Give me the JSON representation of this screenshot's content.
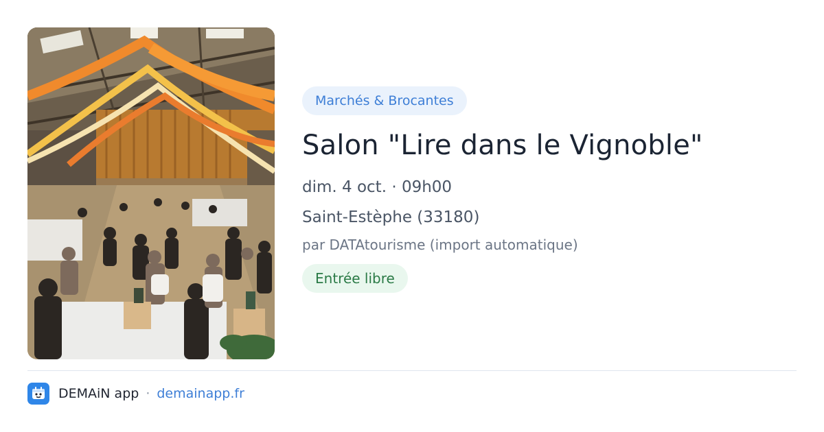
{
  "event": {
    "category": "Marchés & Brocantes",
    "title": "Salon \"Lire dans le Vignoble\"",
    "datetime": "dim. 4 oct. · 09h00",
    "location": "Saint-Estèphe (33180)",
    "source": "par DATAtourisme (import automatique)",
    "price": "Entrée libre",
    "image": "event-photo"
  },
  "footer": {
    "app_icon": "demain-app-icon",
    "app_name": "DEMAiN app",
    "separator": "·",
    "link": "demainapp.fr"
  },
  "colors": {
    "accent": "#3d7ed6",
    "category_bg": "#eaf2fc",
    "price_text": "#2a7a46",
    "price_bg": "#e9f7ee",
    "title": "#1b2433"
  }
}
